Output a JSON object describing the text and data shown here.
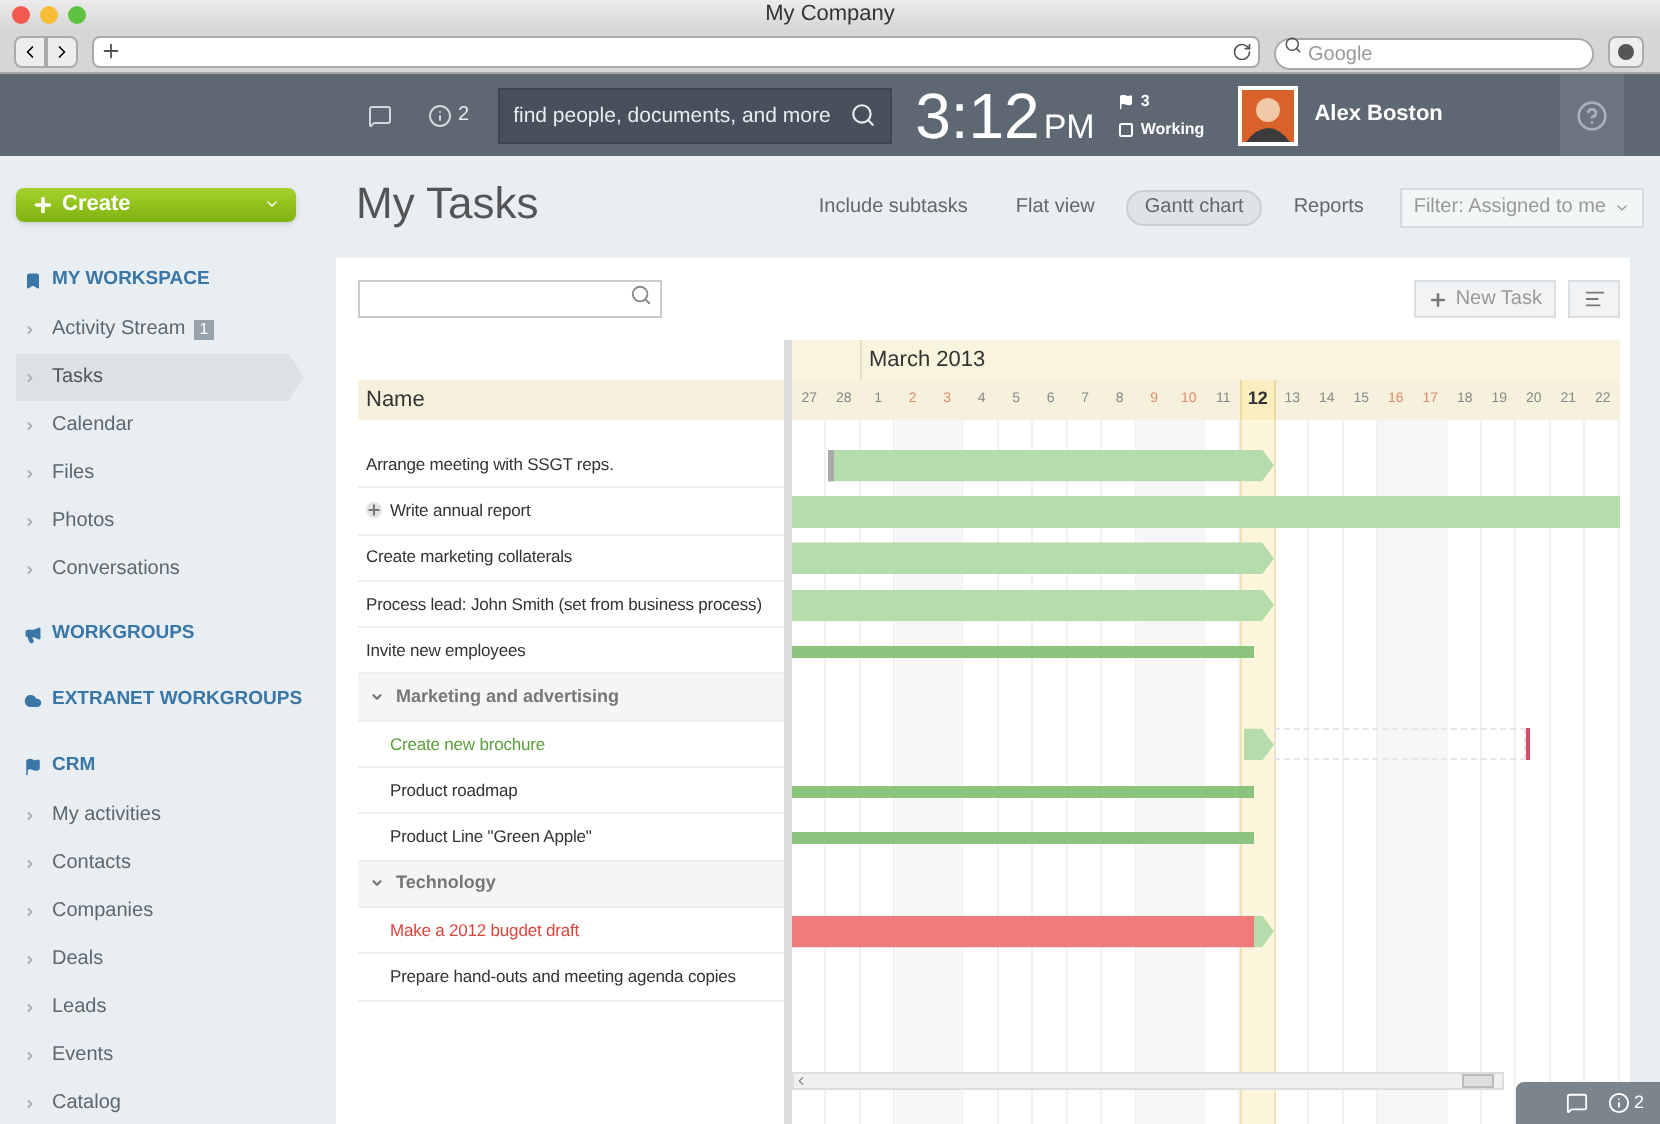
{
  "browser": {
    "title": "My Company",
    "search_placeholder": "Google"
  },
  "header": {
    "notifications": "2",
    "search_placeholder": "find people, documents, and more",
    "time": "3:12",
    "ampm": "PM",
    "flags": "3",
    "status": "Working",
    "user": "Alex Boston"
  },
  "create_button": "Create",
  "sidebar": [
    {
      "title": "MY WORKSPACE",
      "items": [
        {
          "label": "Activity Stream",
          "badge": "1",
          "selected": false
        },
        {
          "label": "Tasks",
          "selected": true
        },
        {
          "label": "Calendar",
          "selected": false
        },
        {
          "label": "Files",
          "selected": false
        },
        {
          "label": "Photos",
          "selected": false
        },
        {
          "label": "Conversations",
          "selected": false
        }
      ]
    },
    {
      "title": "WORKGROUPS"
    },
    {
      "title": "EXTRANET WORKGROUPS"
    },
    {
      "title": "CRM",
      "items": [
        {
          "label": "My activities",
          "selected": false
        },
        {
          "label": "Contacts",
          "selected": false
        },
        {
          "label": "Companies",
          "selected": false
        },
        {
          "label": "Deals",
          "selected": false
        },
        {
          "label": "Leads",
          "selected": false
        },
        {
          "label": "Events",
          "selected": false
        },
        {
          "label": "Catalog",
          "selected": false
        }
      ]
    }
  ],
  "page_title": "My Tasks",
  "tabs": [
    {
      "label": "Include subtasks",
      "selected": false
    },
    {
      "label": "Flat view",
      "selected": false
    },
    {
      "label": "Gantt chart",
      "selected": true
    },
    {
      "label": "Reports",
      "selected": false
    }
  ],
  "filter": "Filter: Assigned to me",
  "new_task": "New Task",
  "gantt": {
    "name_header": "Name",
    "month": "March 2013",
    "days": [
      {
        "label": "27",
        "weekend": false,
        "today": false
      },
      {
        "label": "28",
        "weekend": false,
        "today": false
      },
      {
        "label": "1",
        "weekend": false,
        "today": false
      },
      {
        "label": "2",
        "weekend": true,
        "today": false
      },
      {
        "label": "3",
        "weekend": true,
        "today": false
      },
      {
        "label": "4",
        "weekend": false,
        "today": false
      },
      {
        "label": "5",
        "weekend": false,
        "today": false
      },
      {
        "label": "6",
        "weekend": false,
        "today": false
      },
      {
        "label": "7",
        "weekend": false,
        "today": false
      },
      {
        "label": "8",
        "weekend": false,
        "today": false
      },
      {
        "label": "9",
        "weekend": true,
        "today": false
      },
      {
        "label": "10",
        "weekend": true,
        "today": false
      },
      {
        "label": "11",
        "weekend": false,
        "today": false
      },
      {
        "label": "12",
        "weekend": false,
        "today": true
      },
      {
        "label": "13",
        "weekend": false,
        "today": false
      },
      {
        "label": "14",
        "weekend": false,
        "today": false
      },
      {
        "label": "15",
        "weekend": false,
        "today": false
      },
      {
        "label": "16",
        "weekend": true,
        "today": false
      },
      {
        "label": "17",
        "weekend": true,
        "today": false
      },
      {
        "label": "18",
        "weekend": false,
        "today": false
      },
      {
        "label": "19",
        "weekend": false,
        "today": false
      },
      {
        "label": "20",
        "weekend": false,
        "today": false
      },
      {
        "label": "21",
        "weekend": false,
        "today": false
      },
      {
        "label": "22",
        "weekend": false,
        "today": false
      }
    ],
    "tasks": [
      {
        "name": "Arrange meeting with SSGT reps.",
        "color": "#333333",
        "kind": "started"
      },
      {
        "name": "Write annual report",
        "color": "#333333",
        "kind": "full",
        "expanded": false
      },
      {
        "name": "Create marketing collaterals",
        "color": "#333333",
        "kind": "task"
      },
      {
        "name": "Process lead: John Smith (set from business process)",
        "color": "#333333",
        "kind": "task"
      },
      {
        "name": "Invite new employees",
        "color": "#333333",
        "kind": "thin"
      },
      {
        "group": "Marketing and advertising",
        "expanded": true,
        "children": [
          {
            "name": "Create new brochure",
            "color": "#5a9e3a",
            "kind": "pending"
          },
          {
            "name": "Product roadmap",
            "color": "#333333",
            "kind": "thin"
          },
          {
            "name": "Product Line \"Green Apple\"",
            "color": "#333333",
            "kind": "thin"
          }
        ]
      },
      {
        "group": "Technology",
        "expanded": true,
        "children": [
          {
            "name": "Make a 2012 bugdet draft",
            "color": "#d9453d",
            "kind": "overdue"
          },
          {
            "name": "Prepare hand-outs and meeting agenda copies",
            "color": "#333333",
            "kind": "none"
          }
        ]
      }
    ]
  },
  "footer": {
    "notifications": "2"
  }
}
